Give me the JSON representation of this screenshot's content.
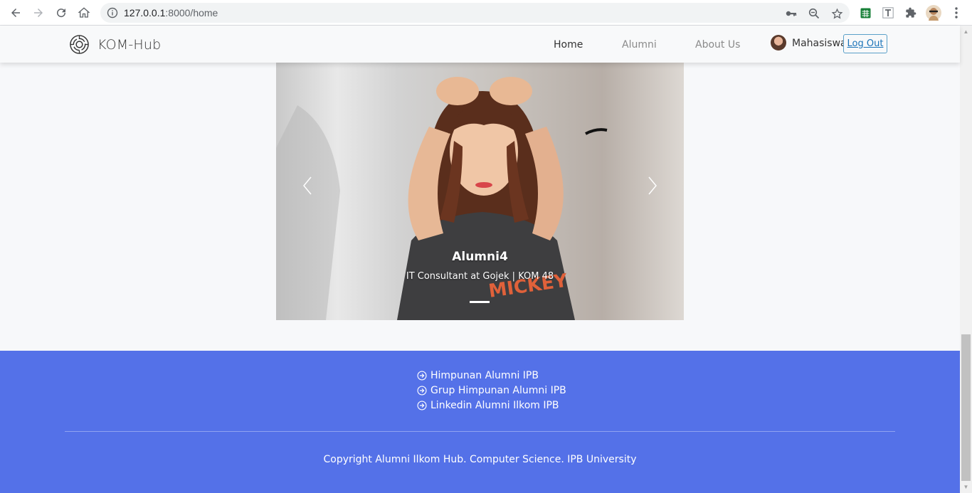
{
  "browser": {
    "url_host": "127.0.0.1",
    "url_path": ":8000/home"
  },
  "navbar": {
    "brand": "KOM-Hub",
    "links": [
      {
        "label": "Home",
        "active": true
      },
      {
        "label": "Alumni",
        "active": false
      },
      {
        "label": "About Us",
        "active": false
      }
    ],
    "user_name": "Mahasiswa",
    "logout_label": "Log Out"
  },
  "carousel": {
    "slides": [
      {
        "title": "Alumni4",
        "subtitle": "IT Consultant at Gojek | KOM 48"
      }
    ],
    "active_index": 0
  },
  "footer": {
    "links": [
      "Himpunan Alumni IPB",
      "Grup Himpunan Alumni IPB",
      "Linkedin Alumni Ilkom IPB"
    ],
    "copyright": "Copyright Alumni Ilkom Hub. Computer Science. IPB University"
  },
  "colors": {
    "footer_bg": "#5471e8",
    "navbar_bg": "#f8f9fa",
    "page_bg": "#f7f8fa"
  }
}
